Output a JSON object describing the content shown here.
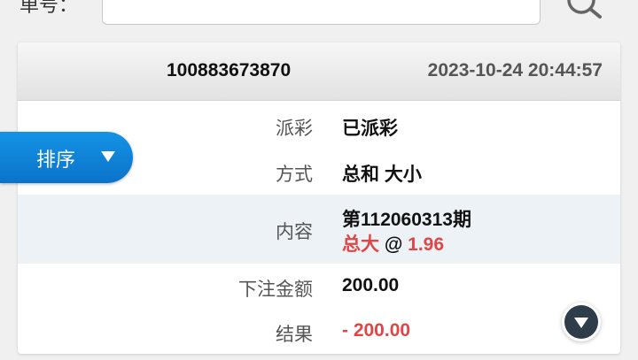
{
  "search": {
    "label": "单号：",
    "value": "",
    "search_icon": "search-icon"
  },
  "order": {
    "id": "100883673870",
    "time": "2023-10-24 20:44:57",
    "fields": {
      "payout": {
        "label": "派彩",
        "value": "已派彩"
      },
      "method": {
        "label": "方式",
        "value": "总和 大小"
      },
      "content": {
        "label": "内容",
        "period": "第112060313期",
        "pick": "总大",
        "at": "@",
        "odds": "1.96"
      },
      "bet_amount": {
        "label": "下注金额",
        "value": "200.00"
      },
      "result": {
        "label": "结果",
        "value": "- 200.00"
      }
    }
  },
  "sort": {
    "label": "排序",
    "icon": "triangle-down-icon"
  },
  "scroll_down": {
    "icon": "triangle-down-icon"
  },
  "colors": {
    "accent_blue": "#0a73c9",
    "negative_red": "#e04646",
    "row_shade": "#ecf2f5",
    "dark_button": "#2f3d4b"
  }
}
